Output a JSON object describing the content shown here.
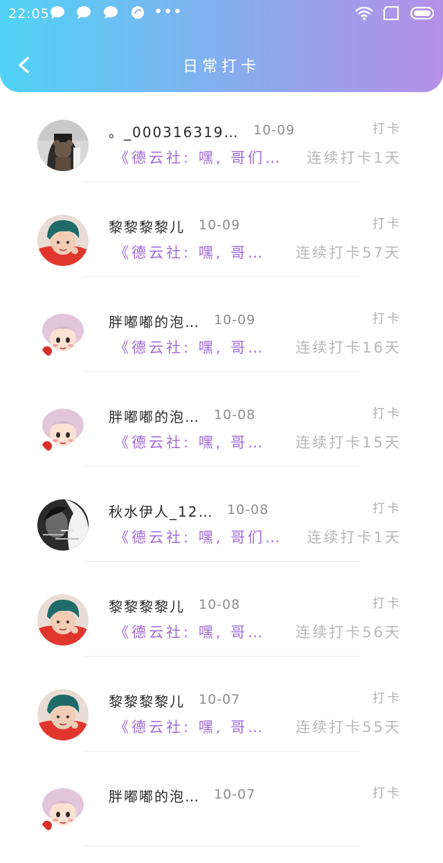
{
  "status_bar": {
    "time": "22:05"
  },
  "header": {
    "title": "日常打卡"
  },
  "entries": [
    {
      "name": "。_000316319…",
      "date": "10-09",
      "tag": "打卡",
      "message": "《德云社: 嘿, 哥们…",
      "streak": "连续打卡1天",
      "avatar": "avatar-bear-backpack"
    },
    {
      "name": "黎黎黎黎儿",
      "date": "10-09",
      "tag": "打卡",
      "message": "《德云社: 嘿, 哥…",
      "streak": "连续打卡57天",
      "avatar": "avatar-teal-hair"
    },
    {
      "name": "胖嘟嘟的泡…",
      "date": "10-09",
      "tag": "打卡",
      "message": "《德云社: 嘿, 哥…",
      "streak": "连续打卡16天",
      "avatar": "avatar-cartoon-girl"
    },
    {
      "name": "胖嘟嘟的泡…",
      "date": "10-08",
      "tag": "打卡",
      "message": "《德云社: 嘿, 哥…",
      "streak": "连续打卡15天",
      "avatar": "avatar-cartoon-girl"
    },
    {
      "name": "秋水伊人_12…",
      "date": "10-08",
      "tag": "打卡",
      "message": "《德云社: 嘿, 哥们…",
      "streak": "连续打卡1天",
      "avatar": "avatar-bw-portrait"
    },
    {
      "name": "黎黎黎黎儿",
      "date": "10-08",
      "tag": "打卡",
      "message": "《德云社: 嘿, 哥…",
      "streak": "连续打卡56天",
      "avatar": "avatar-teal-hair"
    },
    {
      "name": "黎黎黎黎儿",
      "date": "10-07",
      "tag": "打卡",
      "message": "《德云社: 嘿, 哥…",
      "streak": "连续打卡55天",
      "avatar": "avatar-teal-hair"
    },
    {
      "name": "胖嘟嘟的泡…",
      "date": "10-07",
      "tag": "打卡",
      "message": "",
      "streak": "",
      "avatar": "avatar-cartoon-girl"
    }
  ],
  "colors": {
    "header_start": "#4fd2f5",
    "header_end": "#b58fe8",
    "message": "#a06ad8"
  }
}
